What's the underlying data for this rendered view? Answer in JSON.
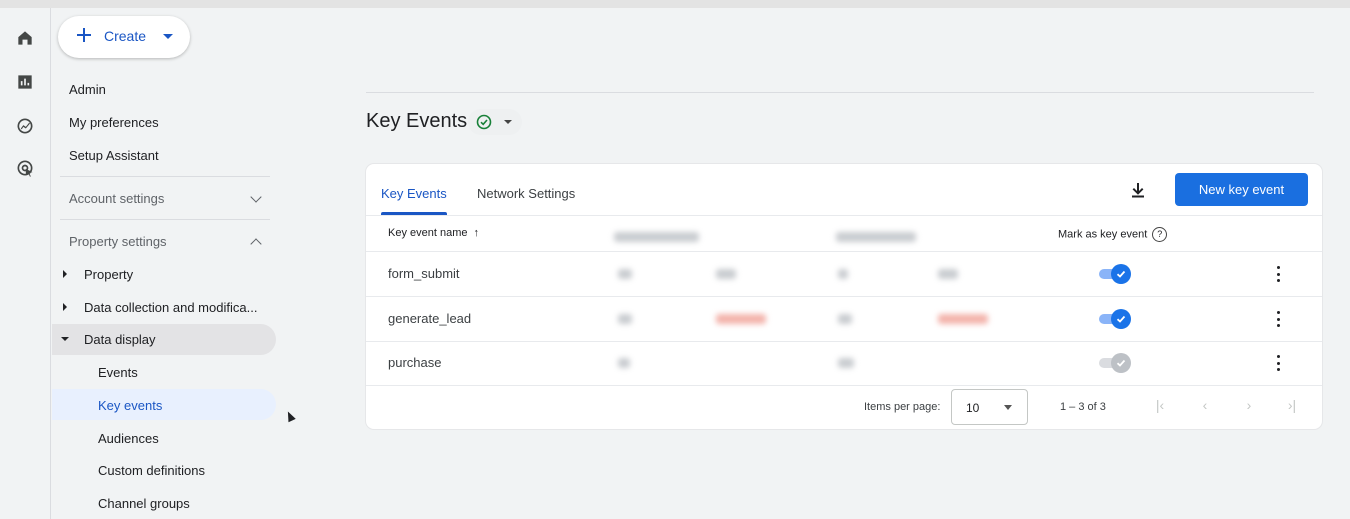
{
  "create": {
    "label": "Create"
  },
  "nav": {
    "top": [
      "Admin",
      "My preferences",
      "Setup Assistant"
    ],
    "account_settings": "Account settings",
    "property_settings": "Property settings",
    "groups": [
      "Property",
      "Data collection and modifica...",
      "Data display"
    ],
    "sub_items": [
      "Events",
      "Key events",
      "Audiences",
      "Custom definitions",
      "Channel groups"
    ]
  },
  "main": {
    "title": "Key Events",
    "tabs": [
      "Key Events",
      "Network Settings"
    ],
    "new_button": "New key event",
    "table": {
      "col_name": "Key event name",
      "col_sort": "↑",
      "col_mark": "Mark as key event",
      "help": "?",
      "rows": [
        {
          "name": "form_submit",
          "key_event": true
        },
        {
          "name": "generate_lead",
          "key_event": true
        },
        {
          "name": "purchase",
          "key_event": false
        }
      ]
    },
    "pagination": {
      "items_per_page_label": "Items per page:",
      "items_per_page": "10",
      "range": "1 – 3 of 3"
    }
  },
  "colors": {
    "accent": "#1a73e8",
    "button": "#1a6fe0"
  },
  "icons": [
    "home-icon",
    "reports-icon",
    "explore-icon",
    "advertising-icon",
    "plus-icon",
    "check-circle-icon",
    "download-icon",
    "more-vert-icon",
    "help-icon"
  ]
}
